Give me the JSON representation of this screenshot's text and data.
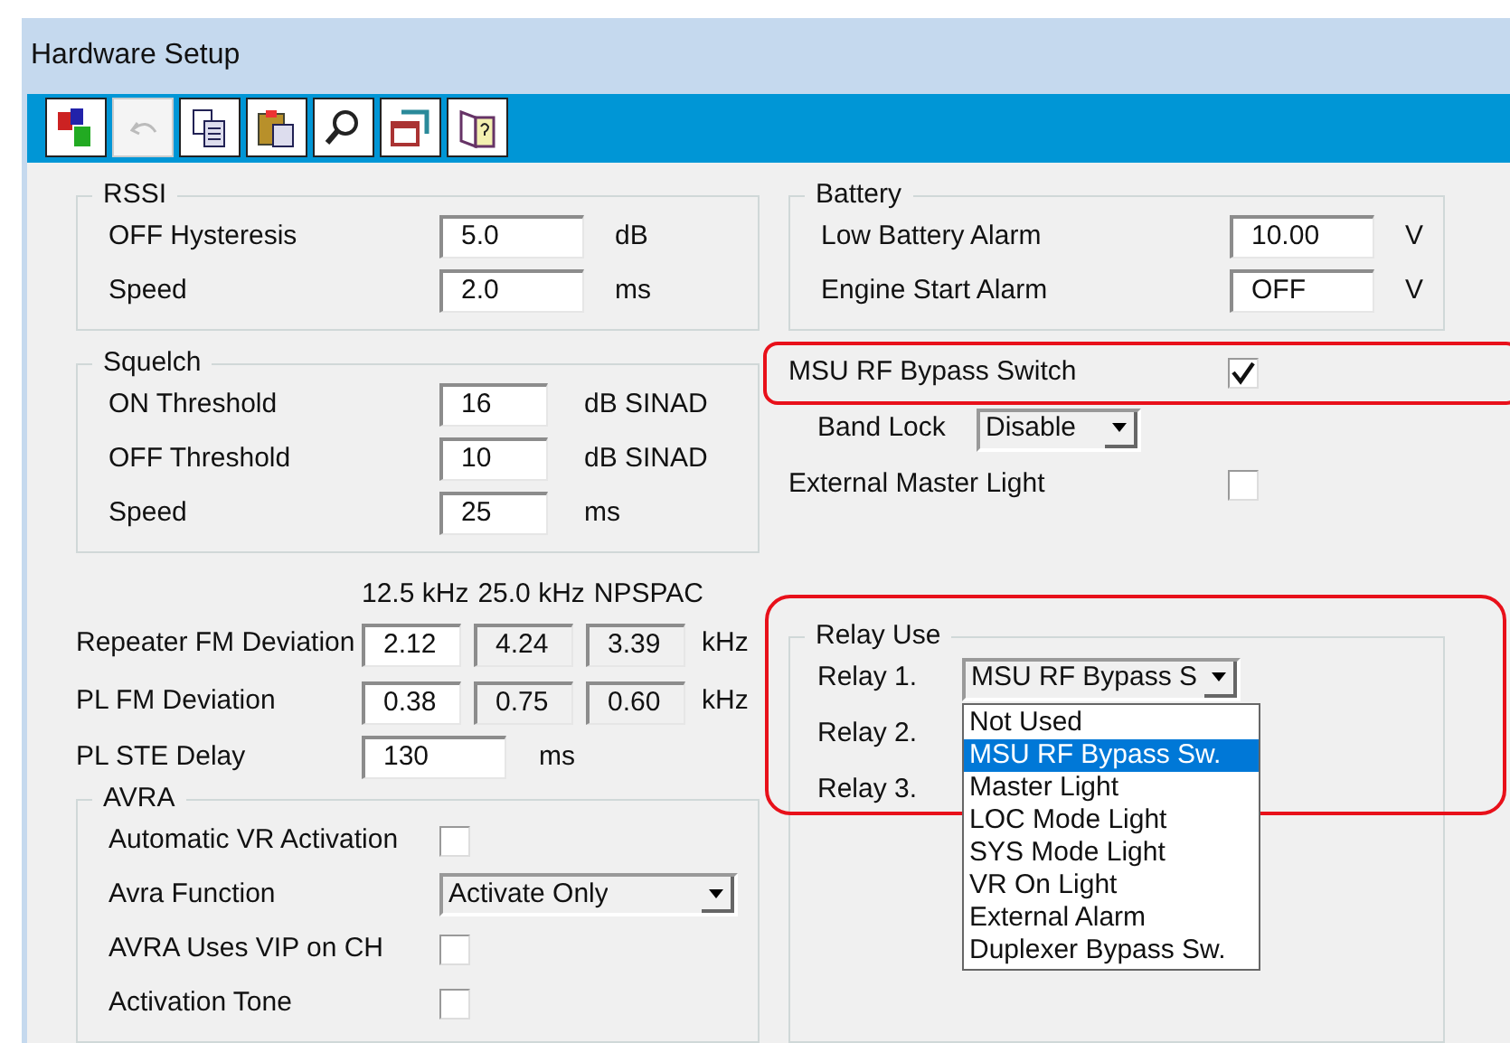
{
  "window": {
    "title": "Hardware Setup"
  },
  "toolbar": [
    {
      "kind": "spell",
      "disabled": false
    },
    {
      "kind": "undo",
      "disabled": true
    },
    {
      "kind": "copy",
      "disabled": false
    },
    {
      "kind": "paste",
      "disabled": false
    },
    {
      "kind": "find",
      "disabled": false
    },
    {
      "kind": "window",
      "disabled": false
    },
    {
      "kind": "help",
      "disabled": false
    }
  ],
  "rssi": {
    "title": "RSSI",
    "rows": [
      {
        "label": "OFF Hysteresis",
        "value": "5.0",
        "unit": "dB"
      },
      {
        "label": "Speed",
        "value": "2.0",
        "unit": "ms"
      }
    ]
  },
  "squelch": {
    "title": "Squelch",
    "rows": [
      {
        "label": "ON Threshold",
        "value": "16",
        "unit": "dB SINAD"
      },
      {
        "label": "OFF Threshold",
        "value": "10",
        "unit": "dB SINAD"
      },
      {
        "label": "Speed",
        "value": "25",
        "unit": "ms"
      }
    ]
  },
  "deviation": {
    "columns": [
      "12.5 kHz",
      "25.0 kHz",
      "NPSPAC"
    ],
    "rows": [
      {
        "label": "Repeater FM Deviation",
        "unit": "kHz",
        "cells": [
          {
            "value": "2.12",
            "disabled": false
          },
          {
            "value": "4.24",
            "disabled": true
          },
          {
            "value": "3.39",
            "disabled": true
          }
        ]
      },
      {
        "label": "PL FM Deviation",
        "unit": "kHz",
        "cells": [
          {
            "value": "0.38",
            "disabled": false
          },
          {
            "value": "0.75",
            "disabled": true
          },
          {
            "value": "0.60",
            "disabled": true
          }
        ]
      }
    ]
  },
  "pl_ste_delay": {
    "label": "PL STE Delay",
    "value": "130",
    "unit": "ms"
  },
  "avra": {
    "title": "AVRA",
    "rows": [
      {
        "kind": "checkbox",
        "label": "Automatic VR Activation",
        "checked": false
      },
      {
        "kind": "dropdown",
        "label": "Avra Function",
        "value": "Activate Only"
      },
      {
        "kind": "checkbox",
        "label": "AVRA Uses VIP on CH",
        "checked": false
      },
      {
        "kind": "checkbox",
        "label": "Activation Tone",
        "checked": false
      }
    ]
  },
  "battery": {
    "title": "Battery",
    "rows": [
      {
        "label": "Low Battery Alarm",
        "value": "10.00",
        "unit": "V"
      },
      {
        "label": "Engine Start Alarm",
        "value": "OFF",
        "unit": "V"
      }
    ]
  },
  "options": [
    {
      "kind": "checkbox",
      "label": "MSU RF Bypass Switch",
      "checked": true,
      "highlighted": true
    },
    {
      "kind": "dropdown",
      "label": "Band Lock",
      "value": "Disable",
      "highlighted": false
    },
    {
      "kind": "checkbox",
      "label": "External Master Light",
      "checked": false,
      "highlighted": false
    }
  ],
  "relay_use": {
    "title": "Relay Use",
    "highlighted": true,
    "relays": [
      {
        "label": "Relay 1.",
        "value": "MSU RF Bypass S",
        "expanded": true,
        "options": [
          {
            "label": "Not Used",
            "selected": false
          },
          {
            "label": "MSU RF Bypass Sw.",
            "selected": true
          },
          {
            "label": "Master Light",
            "selected": false
          },
          {
            "label": "LOC Mode Light",
            "selected": false
          },
          {
            "label": "SYS Mode Light",
            "selected": false
          },
          {
            "label": "VR On Light",
            "selected": false
          },
          {
            "label": "External Alarm",
            "selected": false
          },
          {
            "label": "Duplexer Bypass Sw.",
            "selected": false
          }
        ]
      },
      {
        "label": "Relay 2."
      },
      {
        "label": "Relay 3."
      }
    ]
  }
}
